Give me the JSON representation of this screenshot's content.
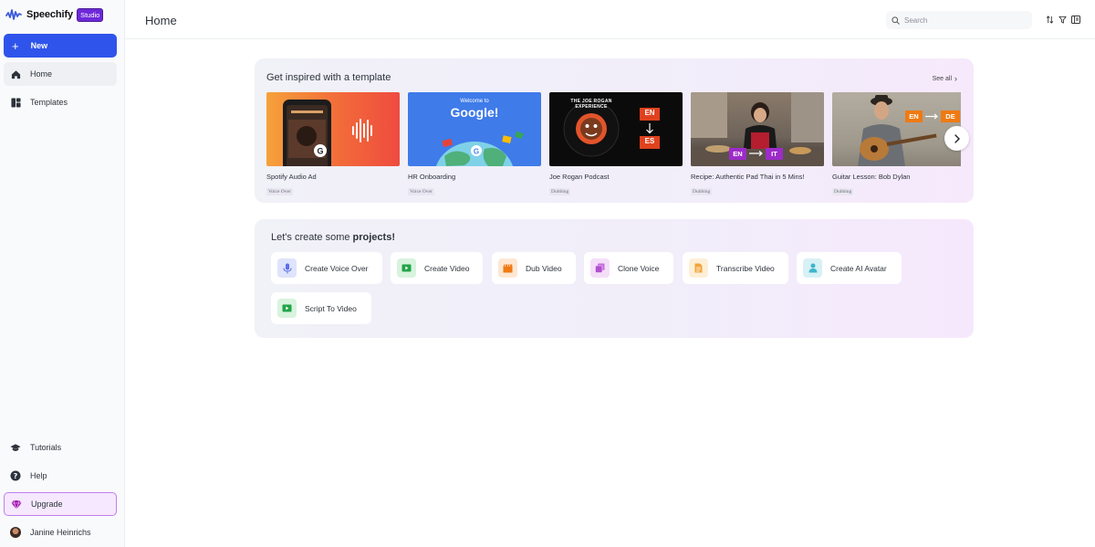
{
  "app": {
    "name": "Speechify",
    "badge": "Studio"
  },
  "sidebar": {
    "new_label": "New",
    "items": [
      {
        "label": "Home",
        "icon": "home-icon",
        "active": true
      },
      {
        "label": "Templates",
        "icon": "templates-icon",
        "active": false
      }
    ],
    "bottom_items": [
      {
        "label": "Tutorials",
        "icon": "graduation-cap-icon"
      },
      {
        "label": "Help",
        "icon": "help-circle-icon"
      },
      {
        "label": "Upgrade",
        "icon": "gem-icon"
      }
    ],
    "user": {
      "name": "Janine Heinrichs"
    }
  },
  "header": {
    "title": "Home",
    "search_placeholder": "Search"
  },
  "inspire": {
    "title": "Get inspired with a template",
    "see_all": "See all",
    "cards": [
      {
        "title": "Spotify Audio Ad",
        "tag": "Voice Over"
      },
      {
        "title": "HR Onboarding",
        "tag": "Voice Over",
        "thumb_text_small": "Welcome to",
        "thumb_text_big": "Google!"
      },
      {
        "title": "Joe Rogan Podcast",
        "tag": "Dubbing",
        "thumb_text": "THE JOE ROGAN EXPERIENCE",
        "lang_from": "EN",
        "lang_to": "ES"
      },
      {
        "title": "Recipe: Authentic Pad Thai in 5 Mins!",
        "tag": "Dubbing",
        "lang_from": "EN",
        "lang_to": "IT"
      },
      {
        "title": "Guitar Lesson: Bob Dylan",
        "tag": "Dubbing",
        "lang_from": "EN",
        "lang_to": "DE"
      }
    ]
  },
  "projects": {
    "title_prefix": "Let's create some ",
    "title_bold": "projects!",
    "buttons": [
      {
        "label": "Create Voice Over",
        "icon": "microphone-icon",
        "color": "#6b7ff2"
      },
      {
        "label": "Create Video",
        "icon": "play-video-icon",
        "color": "#22a447"
      },
      {
        "label": "Dub Video",
        "icon": "clapperboard-icon",
        "color": "#f07a14"
      },
      {
        "label": "Clone Voice",
        "icon": "clone-voice-icon",
        "color": "#c56ee0"
      },
      {
        "label": "Transcribe Video",
        "icon": "document-icon",
        "color": "#f2a43a"
      },
      {
        "label": "Create AI Avatar",
        "icon": "person-icon",
        "color": "#3fb6c9"
      },
      {
        "label": "Script To Video",
        "icon": "play-video-icon",
        "color": "#22a447"
      }
    ]
  },
  "colors": {
    "primary": "#2f54eb",
    "studio_badge": "#6d28d9",
    "upgrade_border": "#c07ff0"
  }
}
